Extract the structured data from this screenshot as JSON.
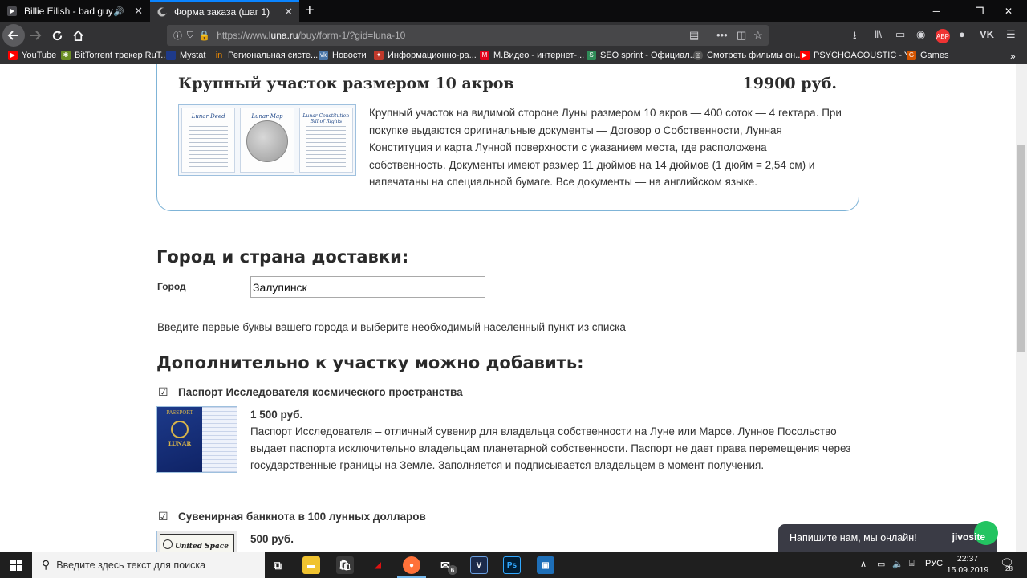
{
  "browser": {
    "tabs": [
      {
        "title": "Billie Eilish - bad guy"
      },
      {
        "title": "Форма заказа (шаг 1)"
      }
    ],
    "url_prefix": "https://www.",
    "url_domain": "luna.ru",
    "url_path": "/buy/form-1/?gid=luna-10",
    "bookmarks": [
      {
        "label": "YouTube",
        "color": "#ff0000"
      },
      {
        "label": "BitTorrent трекер RuT...",
        "color": "#6b8e23"
      },
      {
        "label": "Mystat",
        "color": "#1e3a8a"
      },
      {
        "label": "Региональная систе...",
        "color": "#f28c00"
      },
      {
        "label": "Новости",
        "color": "#4a76a8"
      },
      {
        "label": "Информационно-ра...",
        "color": "#c0392b"
      },
      {
        "label": "М.Видео - интернет-...",
        "color": "#e2001a"
      },
      {
        "label": "SEO sprint - Официал...",
        "color": "#2e8b57"
      },
      {
        "label": "Смотреть фильмы он...",
        "color": "#555555"
      },
      {
        "label": "PSYCHOACOUSTIC - Y...",
        "color": "#ff0000"
      },
      {
        "label": "Games",
        "color": "#d35400"
      }
    ]
  },
  "product": {
    "title": "Крупный участок размером 10 акров",
    "price": "19900 руб.",
    "doc_labels": [
      "Lunar Deed",
      "Lunar Map",
      "Lunar Constitution Bill of Rights"
    ],
    "description": "Крупный участок на видимой стороне Луны размером 10 акров — 400 соток — 4 гектара. При покупке выдаются оригинальные документы — Договор о Собственности, Лунная Конституция и карта Лунной поверхности с указанием места, где расположена собственность. Документы имеют размер 11 дюймов на 14 дюймов (1 дюйм = 2,54 см) и напечатаны на специальной бумаге. Все документы — на английском языке."
  },
  "delivery": {
    "heading": "Город и страна доставки:",
    "city_label": "Город",
    "city_value": "Залупинск",
    "hint": "Введите первые буквы вашего города и выберите необходимый населенный пункт из списка"
  },
  "addons": {
    "heading": "Дополнительно к участку можно добавить:",
    "items": [
      {
        "title": "Паспорт Исследователя космического пространства",
        "price": "1 500 руб.",
        "description": "Паспорт Исследователя – отличный сувенир для владельца собственности на Луне или Марсе. Лунное Посольство выдает паспорта исключительно владельцам планетарной собственности. Паспорт не дает права перемещения через государственные границы на Земле. Заполняется и подписывается владельцем в момент получения.",
        "checked": true,
        "image_text": [
          "PASSPORT",
          "LUNAR"
        ]
      },
      {
        "title": "Сувенирная банкнота в 100 лунных долларов",
        "price": "500 руб.",
        "checked": true,
        "image_text": "United Space o"
      }
    ]
  },
  "chat": {
    "text": "Напишите нам, мы онлайн!",
    "brand": "jivosite"
  },
  "taskbar": {
    "search_placeholder": "Введите здесь текст для поиска",
    "lang": "РУС",
    "time": "22:37",
    "date": "15.09.2019",
    "notifications": "28",
    "mail_badge": "6",
    "app_icons": [
      {
        "name": "task-view",
        "label": "",
        "color": "#1f1f1f"
      },
      {
        "name": "file-explorer",
        "label": "",
        "color": "#f0c330"
      },
      {
        "name": "store",
        "label": "",
        "color": "#3a3a3a"
      },
      {
        "name": "game-app",
        "label": "",
        "color": "#7a0b0b"
      },
      {
        "name": "firefox",
        "label": "",
        "color": "#ff7139"
      },
      {
        "name": "mail",
        "label": "",
        "color": "#1f1f1f"
      },
      {
        "name": "visual-studio",
        "label": "V",
        "color": "#1b2a4a"
      },
      {
        "name": "photoshop",
        "label": "Ps",
        "color": "#001e36"
      },
      {
        "name": "other-app",
        "label": "",
        "color": "#1e6fb8"
      }
    ]
  }
}
